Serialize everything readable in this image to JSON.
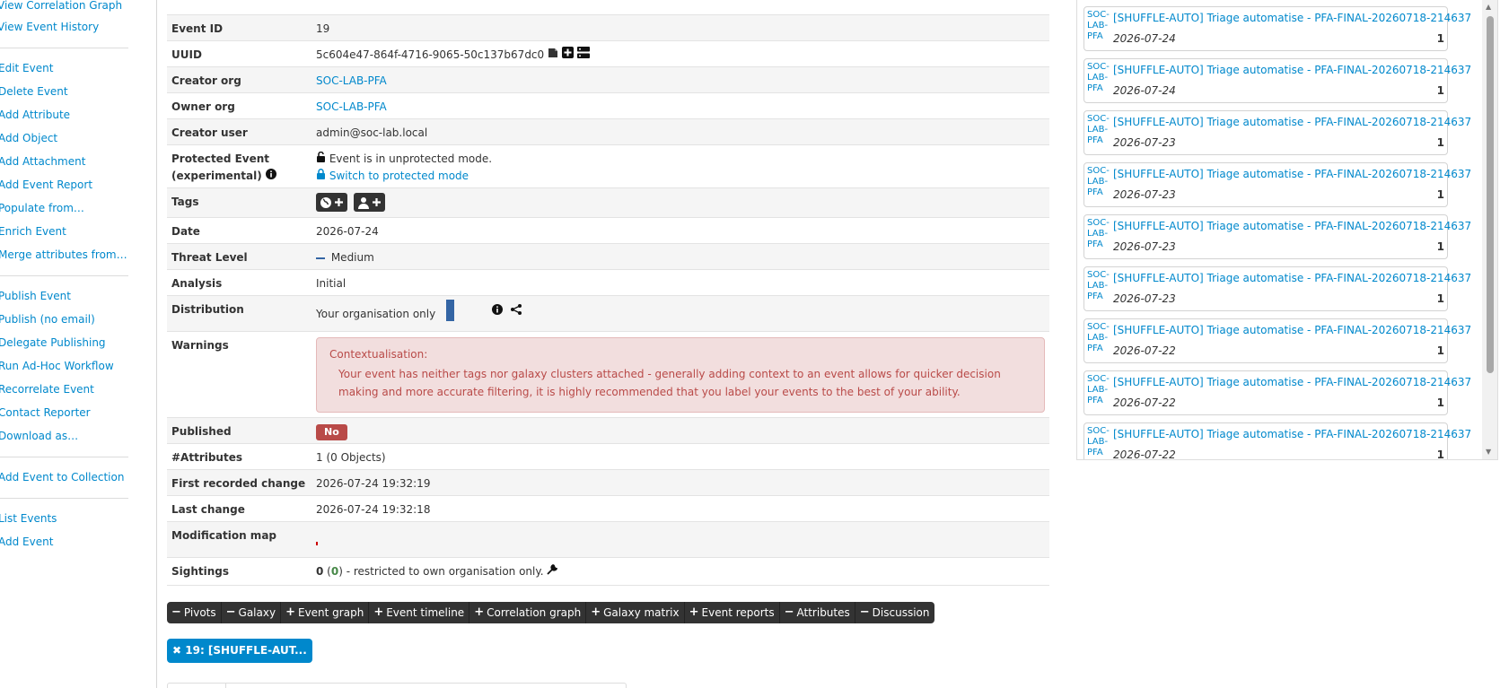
{
  "sidebar": {
    "items": [
      {
        "label": "View Correlation Graph"
      },
      {
        "label": "View Event History"
      },
      {
        "label": "Edit Event"
      },
      {
        "label": "Delete Event"
      },
      {
        "label": "Add Attribute"
      },
      {
        "label": "Add Object"
      },
      {
        "label": "Add Attachment"
      },
      {
        "label": "Add Event Report"
      },
      {
        "label": "Populate from…"
      },
      {
        "label": "Enrich Event"
      },
      {
        "label": "Merge attributes from…"
      },
      {
        "label": "Publish Event"
      },
      {
        "label": "Publish (no email)"
      },
      {
        "label": "Delegate Publishing"
      },
      {
        "label": "Run Ad-Hoc Workflow"
      },
      {
        "label": "Recorrelate Event"
      },
      {
        "label": "Contact Reporter"
      },
      {
        "label": "Download as…"
      },
      {
        "label": "Add Event to Collection"
      },
      {
        "label": "List Events"
      },
      {
        "label": "Add Event"
      }
    ]
  },
  "details": {
    "event_id": {
      "label": "Event ID",
      "value": "19"
    },
    "uuid": {
      "label": "UUID",
      "value": "5c604e47-864f-4716-9065-50c137b67dc0"
    },
    "creator_org": {
      "label": "Creator org",
      "value": "SOC-LAB-PFA"
    },
    "owner_org": {
      "label": "Owner org",
      "value": "SOC-LAB-PFA"
    },
    "creator_user": {
      "label": "Creator user",
      "value": "admin@soc-lab.local"
    },
    "protected": {
      "label": "Protected Event (experimental)",
      "status": "Event is in unprotected mode.",
      "action": "Switch to protected mode"
    },
    "tags": {
      "label": "Tags"
    },
    "date": {
      "label": "Date",
      "value": "2026-07-24"
    },
    "threat_level": {
      "label": "Threat Level",
      "value": "Medium"
    },
    "analysis": {
      "label": "Analysis",
      "value": "Initial"
    },
    "distribution": {
      "label": "Distribution",
      "value": "Your organisation only"
    },
    "warnings": {
      "label": "Warnings",
      "title": "Contextualisation:",
      "text": "Your event has neither tags nor galaxy clusters attached - generally adding context to an event allows for quicker decision making and more accurate filtering, it is highly recommended that you label your events to the best of your ability."
    },
    "published": {
      "label": "Published",
      "value": "No"
    },
    "attributes": {
      "label": "#Attributes",
      "value": "1 (0 Objects)"
    },
    "first_change": {
      "label": "First recorded change",
      "value": "2026-07-24 19:32:19"
    },
    "last_change": {
      "label": "Last change",
      "value": "2026-07-24 19:32:18"
    },
    "modification_map": {
      "label": "Modification map"
    },
    "sightings": {
      "label": "Sightings",
      "count": "0",
      "sub": "0",
      "text": "- restricted to own organisation only."
    }
  },
  "toolbar": [
    {
      "sym": "−",
      "label": "Pivots"
    },
    {
      "sym": "−",
      "label": "Galaxy"
    },
    {
      "sym": "+",
      "label": "Event graph"
    },
    {
      "sym": "+",
      "label": "Event timeline"
    },
    {
      "sym": "+",
      "label": "Correlation graph"
    },
    {
      "sym": "+",
      "label": "Galaxy matrix"
    },
    {
      "sym": "+",
      "label": "Event reports"
    },
    {
      "sym": "−",
      "label": "Attributes"
    },
    {
      "sym": "−",
      "label": "Discussion"
    }
  ],
  "event_tab": {
    "label": "19: [SHUFFLE-AUT..."
  },
  "related": [
    {
      "org": "SOC-LAB-PFA",
      "title": "[SHUFFLE-AUTO] Triage automatise - PFA-FINAL-20260718-214637",
      "date": "2026-07-24",
      "count": "1"
    },
    {
      "org": "SOC-LAB-PFA",
      "title": "[SHUFFLE-AUTO] Triage automatise - PFA-FINAL-20260718-214637",
      "date": "2026-07-24",
      "count": "1"
    },
    {
      "org": "SOC-LAB-PFA",
      "title": "[SHUFFLE-AUTO] Triage automatise - PFA-FINAL-20260718-214637",
      "date": "2026-07-23",
      "count": "1"
    },
    {
      "org": "SOC-LAB-PFA",
      "title": "[SHUFFLE-AUTO] Triage automatise - PFA-FINAL-20260718-214637",
      "date": "2026-07-23",
      "count": "1"
    },
    {
      "org": "SOC-LAB-PFA",
      "title": "[SHUFFLE-AUTO] Triage automatise - PFA-FINAL-20260718-214637",
      "date": "2026-07-23",
      "count": "1"
    },
    {
      "org": "SOC-LAB-PFA",
      "title": "[SHUFFLE-AUTO] Triage automatise - PFA-FINAL-20260718-214637",
      "date": "2026-07-23",
      "count": "1"
    },
    {
      "org": "SOC-LAB-PFA",
      "title": "[SHUFFLE-AUTO] Triage automatise - PFA-FINAL-20260718-214637",
      "date": "2026-07-22",
      "count": "1"
    },
    {
      "org": "SOC-LAB-PFA",
      "title": "[SHUFFLE-AUTO] Triage automatise - PFA-FINAL-20260718-214637",
      "date": "2026-07-22",
      "count": "1"
    },
    {
      "org": "SOC-LAB-PFA",
      "title": "[SHUFFLE-AUTO] Triage automatise - PFA-FINAL-20260718-214637",
      "date": "2026-07-22",
      "count": "1"
    }
  ],
  "colors": {
    "link": "#0088cc",
    "danger": "#b94a48",
    "toolbar": "#333333"
  }
}
